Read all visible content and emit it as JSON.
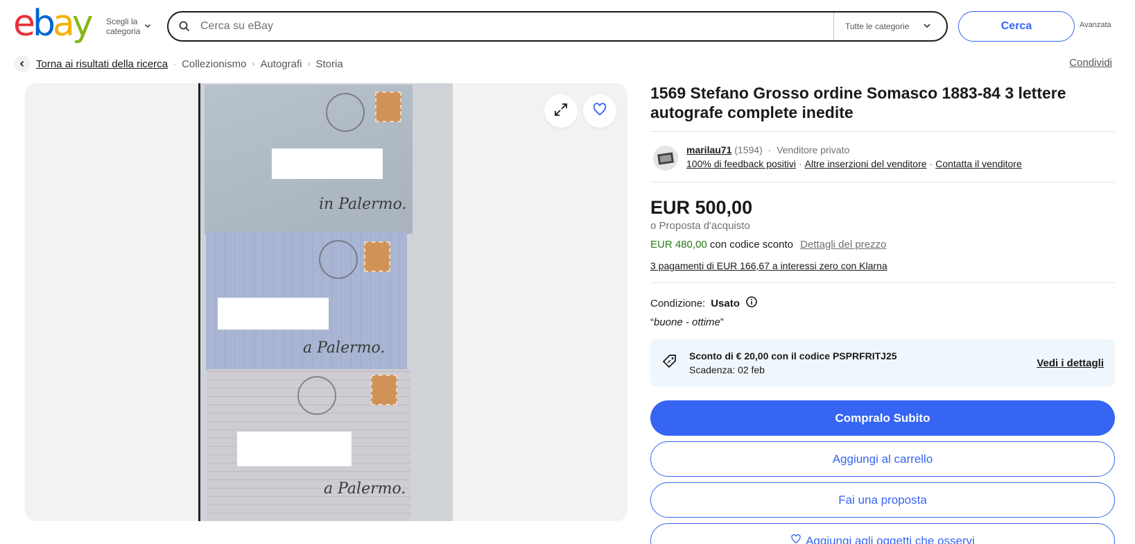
{
  "header": {
    "logo": {
      "e": "e",
      "b": "b",
      "a": "a",
      "y": "y"
    },
    "category_picker": {
      "line1": "Scegli la",
      "line2": "categoria"
    },
    "search": {
      "placeholder": "Cerca su eBay",
      "value": ""
    },
    "category_select": "Tutte le categorie",
    "search_button": "Cerca",
    "advanced_link": "Avanzata"
  },
  "breadcrumb": {
    "back_link": "Torna ai risultati della ricerca",
    "items": [
      "Collezionismo",
      "Autografi",
      "Storia"
    ],
    "share": "Condividi"
  },
  "gallery": {
    "handwriting": [
      "in Palermo.",
      "a Palermo.",
      "a Palermo."
    ]
  },
  "listing": {
    "title": "1569 Stefano Grosso ordine Somasco 1883-84 3 lettere autografe complete inedite",
    "seller": {
      "name": "marilau71",
      "score": "(1594)",
      "type": "Venditore privato",
      "feedback": "100% di feedback positivi",
      "other_listings": "Altre inserzioni del venditore",
      "contact": "Contatta il venditore"
    },
    "price": "EUR 500,00",
    "offer": "o Proposta d'acquisto",
    "discount_price": "EUR 480,00",
    "discount_suffix": "con codice sconto",
    "price_details": "Dettagli del prezzo",
    "klarna": "3 pagamenti di EUR 166,67 a interessi zero con Klarna",
    "condition_label": "Condizione:",
    "condition_value": "Usato",
    "condition_note": "buone - ottime",
    "promo": {
      "line1": "Sconto di € 20,00 con il codice PSPRFRITJ25",
      "line2": "Scadenza: 02 feb",
      "link": "Vedi i dettagli"
    },
    "buttons": {
      "buy_now": "Compralo Subito",
      "add_to_cart": "Aggiungi al carrello",
      "make_offer": "Fai una proposta",
      "watchlist": "Aggiungi agli oggetti che osservi"
    }
  },
  "colors": {
    "accent": "#3665f3",
    "discount_green": "#2a7a1a",
    "promo_bg": "#f0f7fc"
  }
}
